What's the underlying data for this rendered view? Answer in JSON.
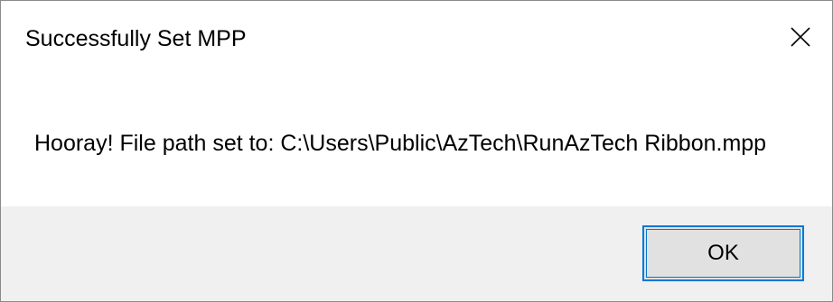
{
  "dialog": {
    "title": "Successfully Set MPP",
    "message": "Hooray! File path set to: C:\\Users\\Public\\AzTech\\RunAzTech Ribbon.mpp",
    "ok_label": "OK",
    "close_icon": "close-icon"
  },
  "colors": {
    "accent": "#0078d7",
    "button_area_bg": "#f0f0f0",
    "button_bg": "#e1e1e1",
    "border": "#8a8a8a"
  }
}
